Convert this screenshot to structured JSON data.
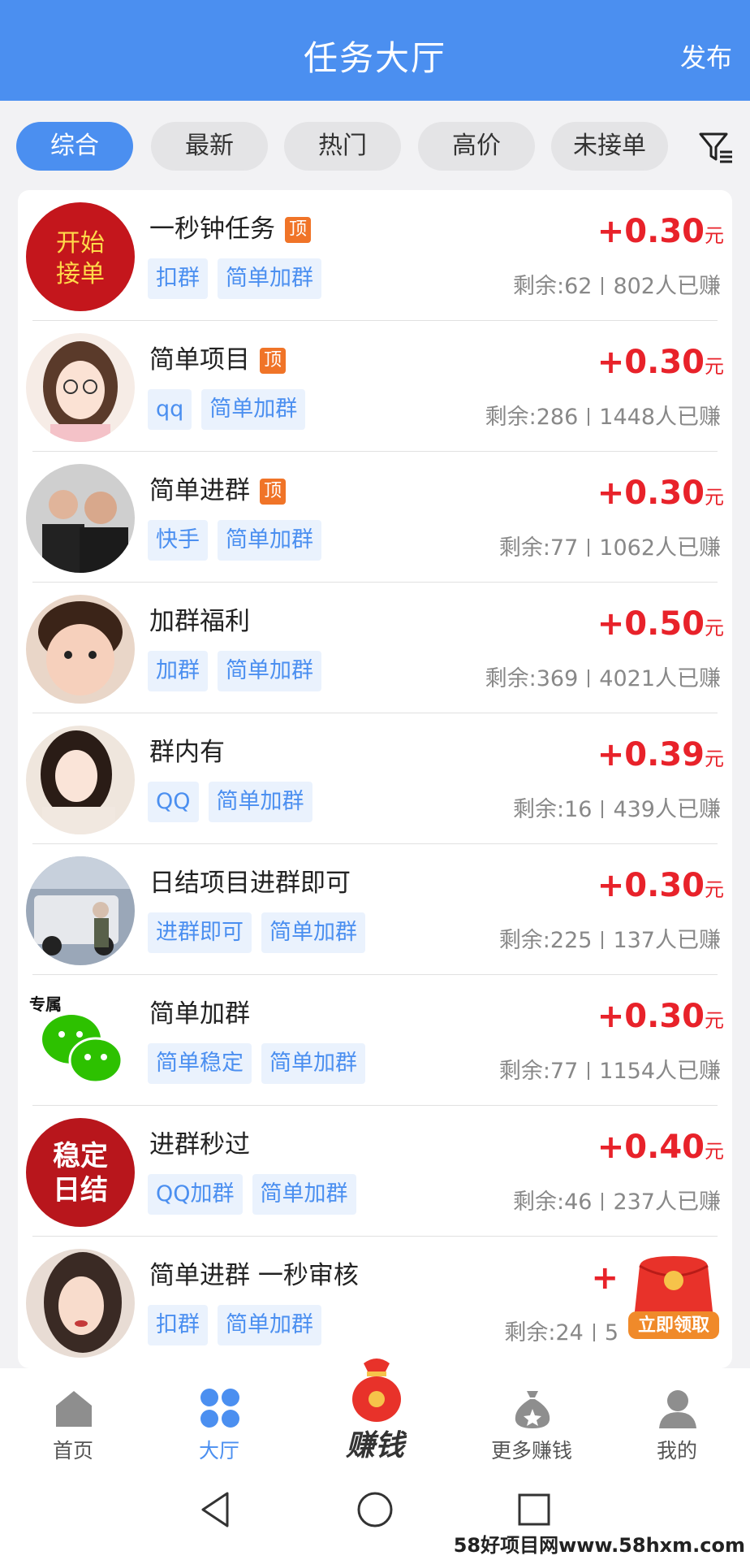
{
  "header": {
    "title": "任务大厅",
    "publish": "发布"
  },
  "filters": [
    "综合",
    "最新",
    "热门",
    "高价",
    "未接单"
  ],
  "tasks": [
    {
      "title": "一秒钟任务",
      "top": "顶",
      "tags": [
        "扣群",
        "简单加群"
      ],
      "reward": "+0.30",
      "unit": "元",
      "remaining": "剩余:62",
      "earned": "802人已赚",
      "avatar_text": [
        "开始",
        "接单"
      ]
    },
    {
      "title": "简单项目",
      "top": "顶",
      "tags": [
        "qq",
        "简单加群"
      ],
      "reward": "+0.30",
      "unit": "元",
      "remaining": "剩余:286",
      "earned": "1448人已赚"
    },
    {
      "title": "简单进群",
      "top": "顶",
      "tags": [
        "快手",
        "简单加群"
      ],
      "reward": "+0.30",
      "unit": "元",
      "remaining": "剩余:77",
      "earned": "1062人已赚"
    },
    {
      "title": "加群福利",
      "top": "",
      "tags": [
        "加群",
        "简单加群"
      ],
      "reward": "+0.50",
      "unit": "元",
      "remaining": "剩余:369",
      "earned": "4021人已赚"
    },
    {
      "title": "群内有",
      "top": "",
      "tags": [
        "QQ",
        "简单加群"
      ],
      "reward": "+0.39",
      "unit": "元",
      "remaining": "剩余:16",
      "earned": "439人已赚"
    },
    {
      "title": "日结项目进群即可",
      "top": "",
      "tags": [
        "进群即可",
        "简单加群"
      ],
      "reward": "+0.30",
      "unit": "元",
      "remaining": "剩余:225",
      "earned": "137人已赚"
    },
    {
      "title": "简单加群",
      "top": "",
      "tags": [
        "简单稳定",
        "简单加群"
      ],
      "reward": "+0.30",
      "unit": "元",
      "remaining": "剩余:77",
      "earned": "1154人已赚",
      "avatar_text": [
        "专属"
      ]
    },
    {
      "title": "进群秒过",
      "top": "",
      "tags": [
        "QQ加群",
        "简单加群"
      ],
      "reward": "+0.40",
      "unit": "元",
      "remaining": "剩余:46",
      "earned": "237人已赚",
      "avatar_text": [
        "稳定",
        "日结"
      ]
    },
    {
      "title": "简单进群 一秒审核",
      "top": "",
      "tags": [
        "扣群",
        "简单加群"
      ],
      "reward": "+",
      "unit": "",
      "remaining": "剩余:24",
      "earned": "5"
    }
  ],
  "promo": {
    "label": "立即领取"
  },
  "tabbar": [
    {
      "label": "首页",
      "icon": "home-icon"
    },
    {
      "label": "大厅",
      "icon": "grid-icon"
    },
    {
      "label": "赚钱",
      "icon": "money-bag-icon"
    },
    {
      "label": "更多赚钱",
      "icon": "money-sack-icon"
    },
    {
      "label": "我的",
      "icon": "user-icon"
    }
  ],
  "watermark": "58好项目网www.58hxm.com",
  "colors": {
    "primary": "#4b8ff0",
    "reward": "#e8222a",
    "top_badge": "#f07428"
  }
}
